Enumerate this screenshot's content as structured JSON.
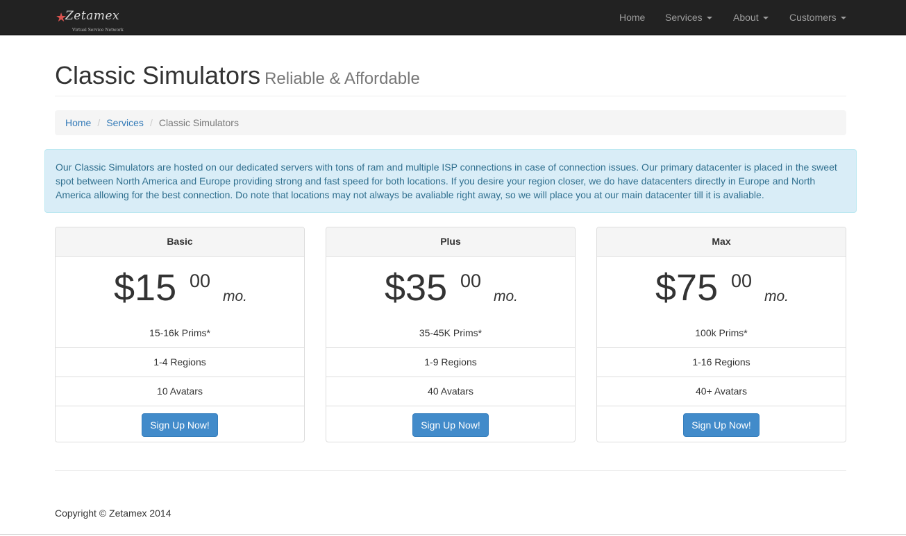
{
  "brand": {
    "logo_text": "Zetamex",
    "tagline": "Virtual Service Network"
  },
  "nav": {
    "home": "Home",
    "services": "Services",
    "about": "About",
    "customers": "Customers"
  },
  "header": {
    "title": "Classic Simulators",
    "subtitle": "Reliable & Affordable"
  },
  "breadcrumb": {
    "home": "Home",
    "services": "Services",
    "current": "Classic Simulators"
  },
  "alert": {
    "text": "Our Classic Simulators are hosted on our dedicated servers with tons of ram and multiple ISP connections in case of connection issues. Our primary datacenter is placed in the sweet spot between North America and Europe providing strong and fast speed for both locations. If you desire your region closer, we do have datacenters directly in Europe and North America allowing for the best connection. Do note that locations may not always be avaliable right away, so we will place you at our main datacenter till it is avaliable."
  },
  "plans": [
    {
      "name": "Basic",
      "price": "$15",
      "cents": "00",
      "period": "mo.",
      "features": [
        "15-16k Prims*",
        "1-4 Regions",
        "10 Avatars"
      ],
      "button": "Sign Up Now!"
    },
    {
      "name": "Plus",
      "price": "$35",
      "cents": "00",
      "period": "mo.",
      "features": [
        "35-45K Prims*",
        "1-9 Regions",
        "40 Avatars"
      ],
      "button": "Sign Up Now!"
    },
    {
      "name": "Max",
      "price": "$75",
      "cents": "00",
      "period": "mo.",
      "features": [
        "100k Prims*",
        "1-16 Regions",
        "40+ Avatars"
      ],
      "button": "Sign Up Now!"
    }
  ],
  "footer": {
    "copyright": "Copyright © Zetamex 2014"
  },
  "colors": {
    "navbar": "#222222",
    "nav_text": "#9d9d9d",
    "link": "#337ab7",
    "alert_bg": "#d9edf7",
    "alert_text": "#31708f",
    "button": "#428bca"
  },
  "icons": {
    "logo": "star-logo-icon",
    "dropdown": "caret-down-icon"
  }
}
